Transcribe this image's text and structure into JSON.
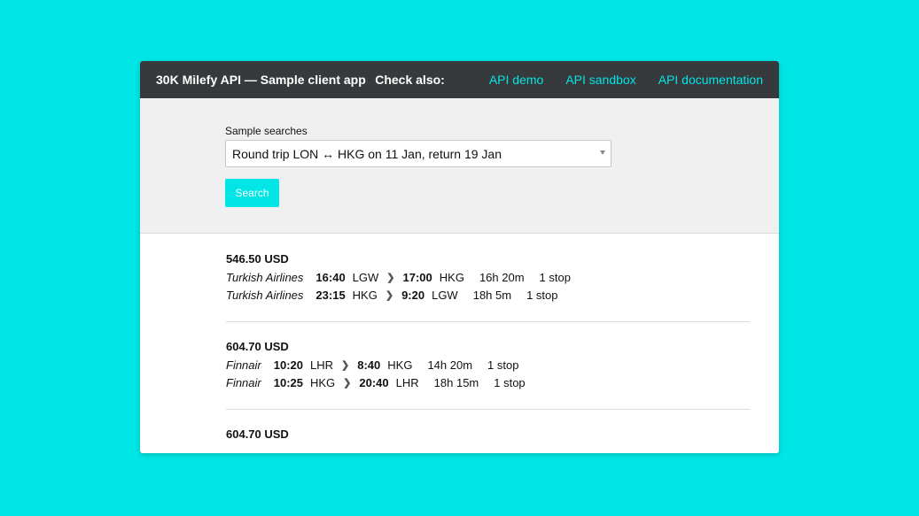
{
  "header": {
    "title": "30K Milefy API — Sample client app",
    "check_also": "Check also:",
    "links": [
      "API demo",
      "API sandbox",
      "API documentation"
    ]
  },
  "search": {
    "label": "Sample searches",
    "selected": "Round trip LON ↔ HKG on 11 Jan, return 19 Jan",
    "button": "Search"
  },
  "results": [
    {
      "price": "546.50 USD",
      "legs": [
        {
          "airline": "Turkish Airlines",
          "dep_time": "16:40",
          "dep_airport": "LGW",
          "arr_time": "17:00",
          "arr_airport": "HKG",
          "duration": "16h 20m",
          "stops": "1 stop"
        },
        {
          "airline": "Turkish Airlines",
          "dep_time": "23:15",
          "dep_airport": "HKG",
          "arr_time": "9:20",
          "arr_airport": "LGW",
          "duration": "18h 5m",
          "stops": "1 stop"
        }
      ]
    },
    {
      "price": "604.70 USD",
      "legs": [
        {
          "airline": "Finnair",
          "dep_time": "10:20",
          "dep_airport": "LHR",
          "arr_time": "8:40",
          "arr_airport": "HKG",
          "duration": "14h 20m",
          "stops": "1 stop"
        },
        {
          "airline": "Finnair",
          "dep_time": "10:25",
          "dep_airport": "HKG",
          "arr_time": "20:40",
          "arr_airport": "LHR",
          "duration": "18h 15m",
          "stops": "1 stop"
        }
      ]
    },
    {
      "price": "604.70 USD",
      "legs": []
    }
  ],
  "colors": {
    "background": "#00e5e5",
    "header_bg": "#373a3c",
    "accent": "#00e5e5",
    "panel_bg": "#f0f0f0"
  },
  "icons": {
    "chevron": "chevron-right-icon",
    "dropdown": "dropdown-arrow-icon"
  }
}
